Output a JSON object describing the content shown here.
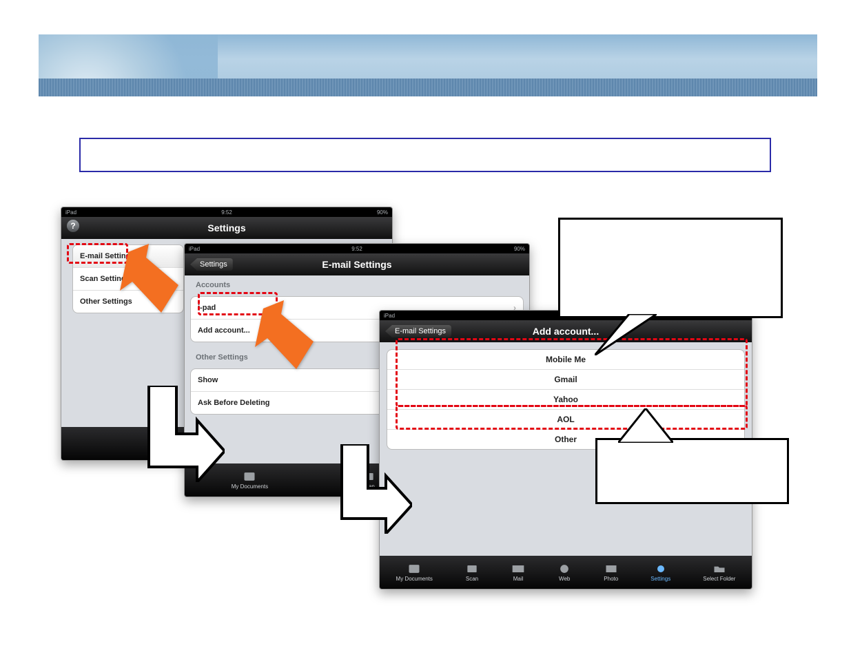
{
  "status": {
    "device": "iPad",
    "time": "9:52",
    "battery": "90%"
  },
  "screen1": {
    "title": "Settings",
    "sidebar": [
      "E-mail Settings",
      "Scan Settings",
      "Other Settings"
    ]
  },
  "screen2": {
    "back": "Settings",
    "title": "E-mail Settings",
    "section_accounts": "Accounts",
    "rows_accounts": [
      "i-pad",
      "Add account..."
    ],
    "section_other": "Other Settings",
    "rows_other": [
      "Show",
      "Ask Before Deleting"
    ]
  },
  "screen3": {
    "back": "E-mail Settings",
    "title": "Add account...",
    "providers": [
      "Mobile Me",
      "Gmail",
      "Yahoo",
      "AOL",
      "Other"
    ]
  },
  "tabs": [
    "My Documents",
    "Scan",
    "Mail",
    "Web",
    "Photo",
    "Settings",
    "Select Folder"
  ],
  "help_glyph": "?"
}
